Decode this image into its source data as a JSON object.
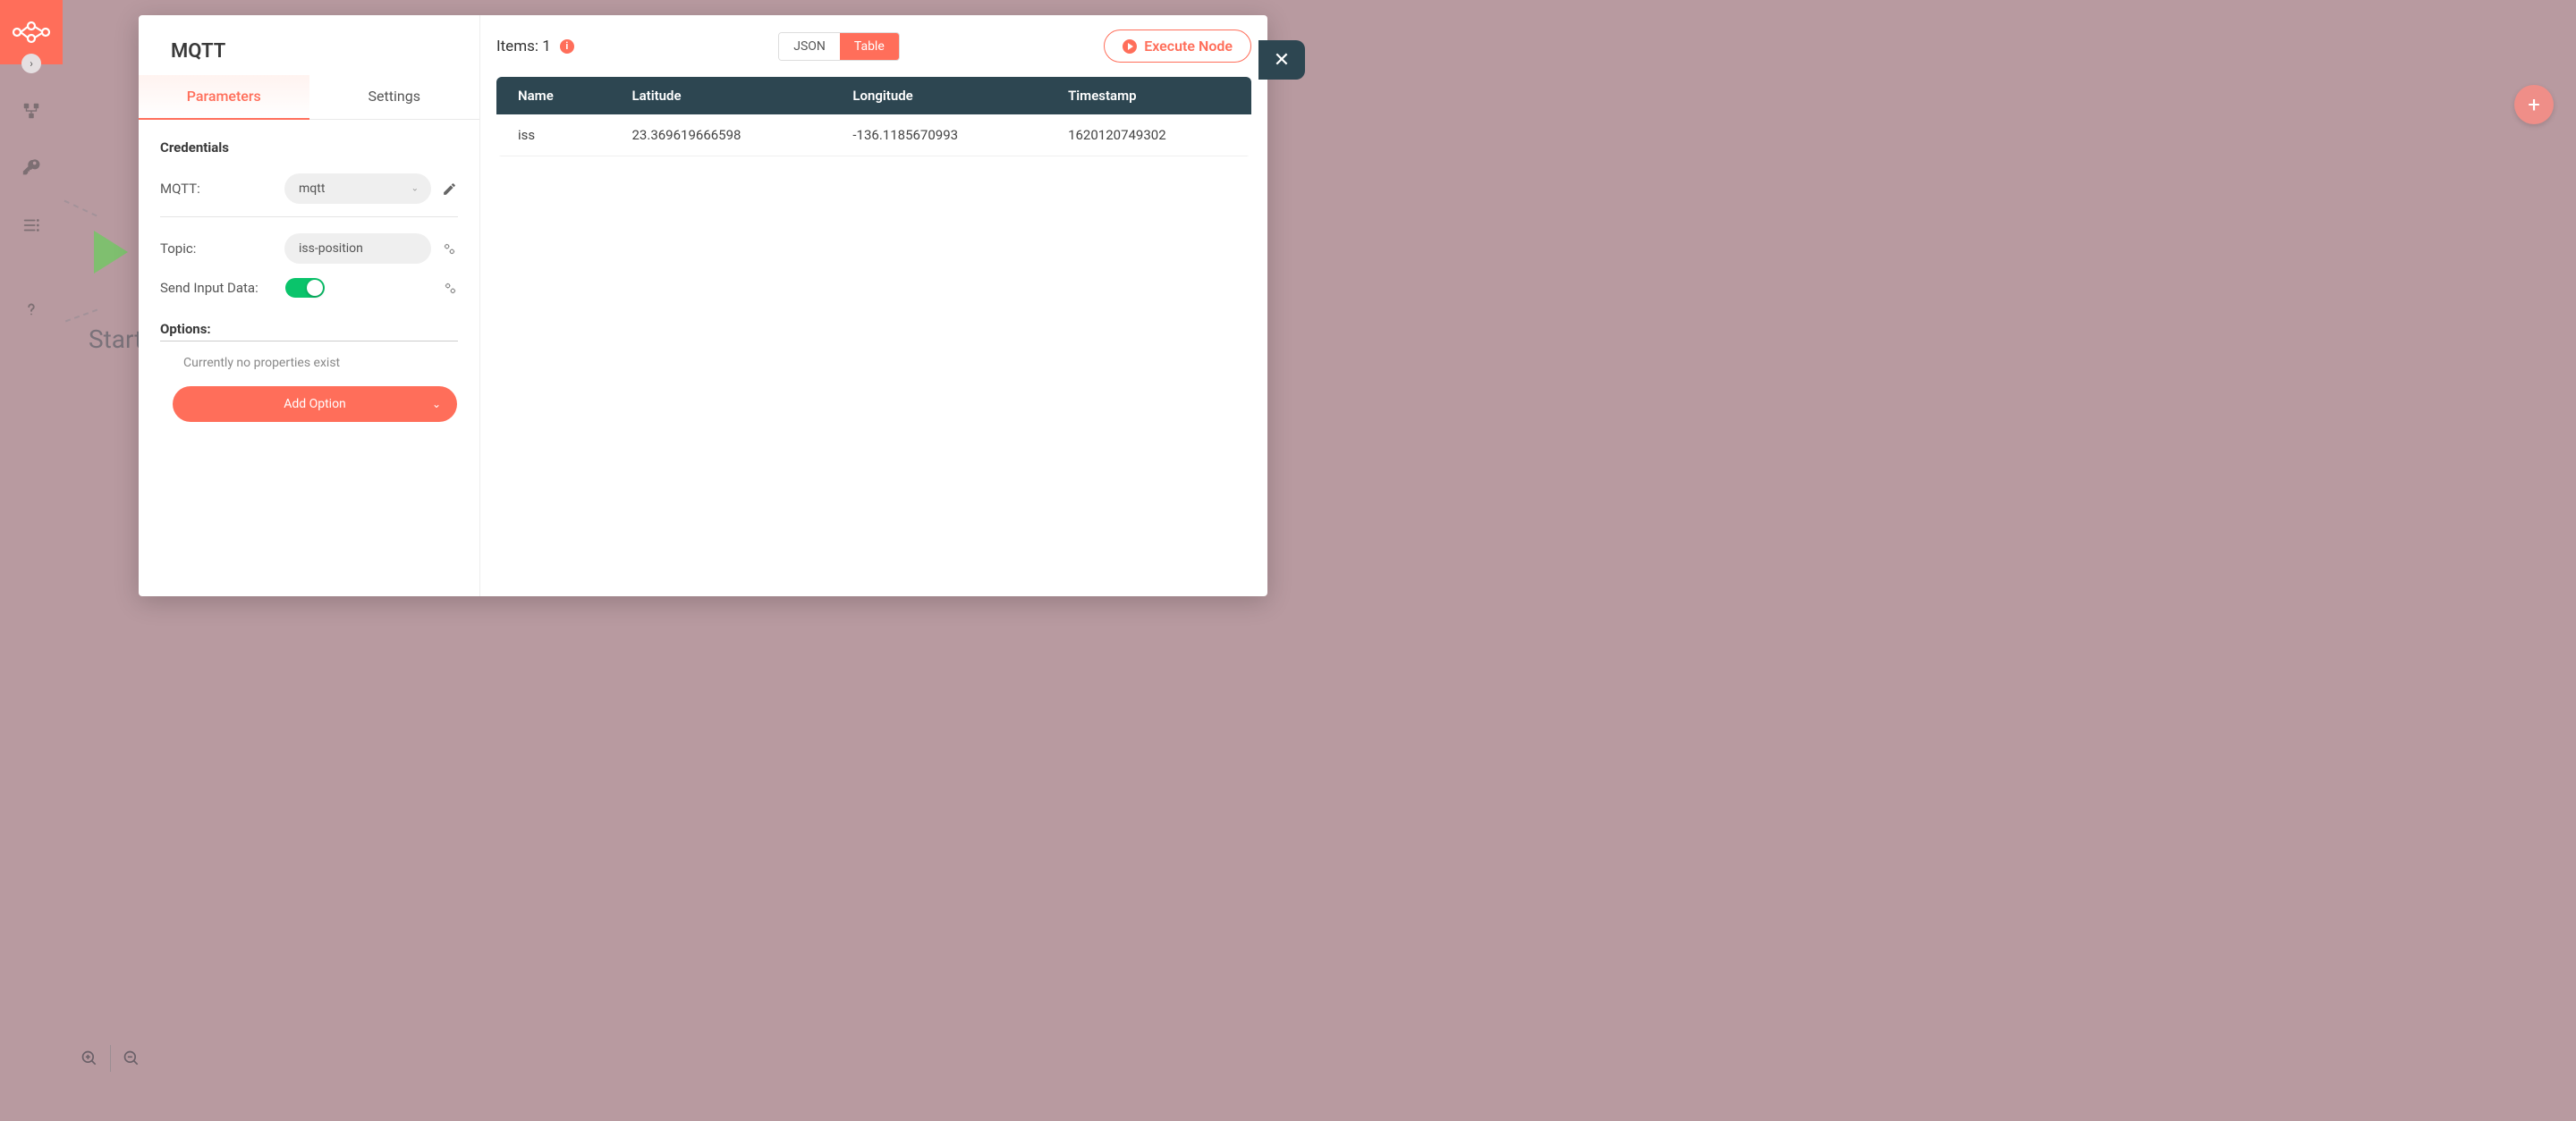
{
  "sidebar": {
    "expand_icon": "›"
  },
  "canvas": {
    "start_label": "Start",
    "fab_plus": "+"
  },
  "modal": {
    "title": "MQTT",
    "tabs": {
      "parameters": "Parameters",
      "settings": "Settings"
    },
    "credentials": {
      "heading": "Credentials",
      "mqtt_label": "MQTT:",
      "mqtt_value": "mqtt",
      "topic_label": "Topic:",
      "topic_value": "iss-position",
      "send_input_label": "Send Input Data:"
    },
    "options": {
      "heading": "Options:",
      "empty_text": "Currently no properties exist",
      "add_button": "Add Option"
    },
    "close_glyph": "✕"
  },
  "output": {
    "items_prefix": "Items: ",
    "items_count": "1",
    "info_glyph": "i",
    "view_json": "JSON",
    "view_table": "Table",
    "execute_label": "Execute Node",
    "columns": [
      "Name",
      "Latitude",
      "Longitude",
      "Timestamp"
    ],
    "rows": [
      {
        "name": "iss",
        "latitude": "23.369619666598",
        "longitude": "-136.1185670993",
        "timestamp": "1620120749302"
      }
    ]
  }
}
